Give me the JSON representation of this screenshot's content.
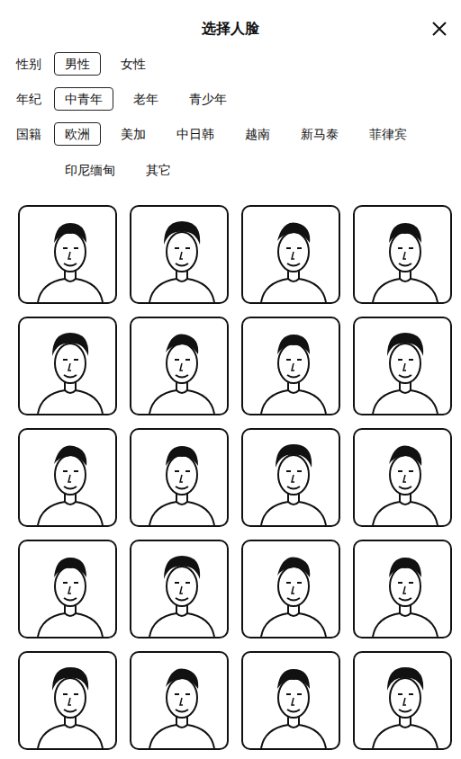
{
  "dialog": {
    "title": "选择人脸"
  },
  "filters": [
    {
      "label": "性别",
      "options": [
        {
          "label": "男性",
          "selected": true
        },
        {
          "label": "女性",
          "selected": false
        }
      ]
    },
    {
      "label": "年纪",
      "options": [
        {
          "label": "中青年",
          "selected": true
        },
        {
          "label": "老年",
          "selected": false
        },
        {
          "label": "青少年",
          "selected": false
        }
      ]
    },
    {
      "label": "国籍",
      "options": [
        {
          "label": "欧洲",
          "selected": true
        },
        {
          "label": "美加",
          "selected": false
        },
        {
          "label": "中日韩",
          "selected": false
        },
        {
          "label": "越南",
          "selected": false
        },
        {
          "label": "新马泰",
          "selected": false
        },
        {
          "label": "菲律宾",
          "selected": false
        },
        {
          "label": "印尼缅甸",
          "selected": false
        },
        {
          "label": "其它",
          "selected": false
        }
      ]
    }
  ],
  "face_count": 20
}
